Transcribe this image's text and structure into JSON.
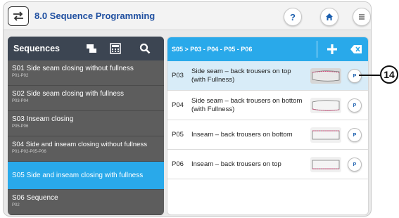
{
  "header": {
    "title": "8.0 Sequence Programming",
    "help_label": "?",
    "app_icon": "swap-arrows-icon",
    "home_icon": "home-icon",
    "menu_icon": "menu-icon"
  },
  "sequences_panel": {
    "title": "Sequences",
    "icons": [
      "copy-icon",
      "calculator-icon",
      "search-icon"
    ],
    "items": [
      {
        "name": "S01  Side seam closing without fullness",
        "sub": "P01-P02"
      },
      {
        "name": "S02  Side seam closing with fullness",
        "sub": "P03-P04"
      },
      {
        "name": "S03  Inseam closing",
        "sub": "P05-P06"
      },
      {
        "name": "S04  Side and inseam closing without fullness",
        "sub": "P01-P02-P05-P06"
      },
      {
        "name": "S05  Side and inseam closing with fullness",
        "sub": ""
      },
      {
        "name": "S06  Sequence",
        "sub": "P02"
      }
    ],
    "active_index": 4
  },
  "programs_panel": {
    "breadcrumb": "S05 > P03 - P04 - P05 - P06",
    "add_icon": "plus-icon",
    "delete_icon": "backspace-icon",
    "rows": [
      {
        "code": "P03",
        "label": "Side seam – back trousers on top (with Fullness)",
        "button": "P"
      },
      {
        "code": "P04",
        "label": "Side seam – back trousers on bottom (with Fullness)",
        "button": "P"
      },
      {
        "code": "P05",
        "label": "Inseam – back trousers on bottom",
        "button": "P"
      },
      {
        "code": "P06",
        "label": "Inseam – back trousers on top",
        "button": "P"
      }
    ],
    "selected_index": 0
  },
  "callout": {
    "number": "14"
  },
  "colors": {
    "accent": "#29a9ea",
    "title_blue": "#1f4fa0",
    "panel_dark": "#3c4552"
  }
}
